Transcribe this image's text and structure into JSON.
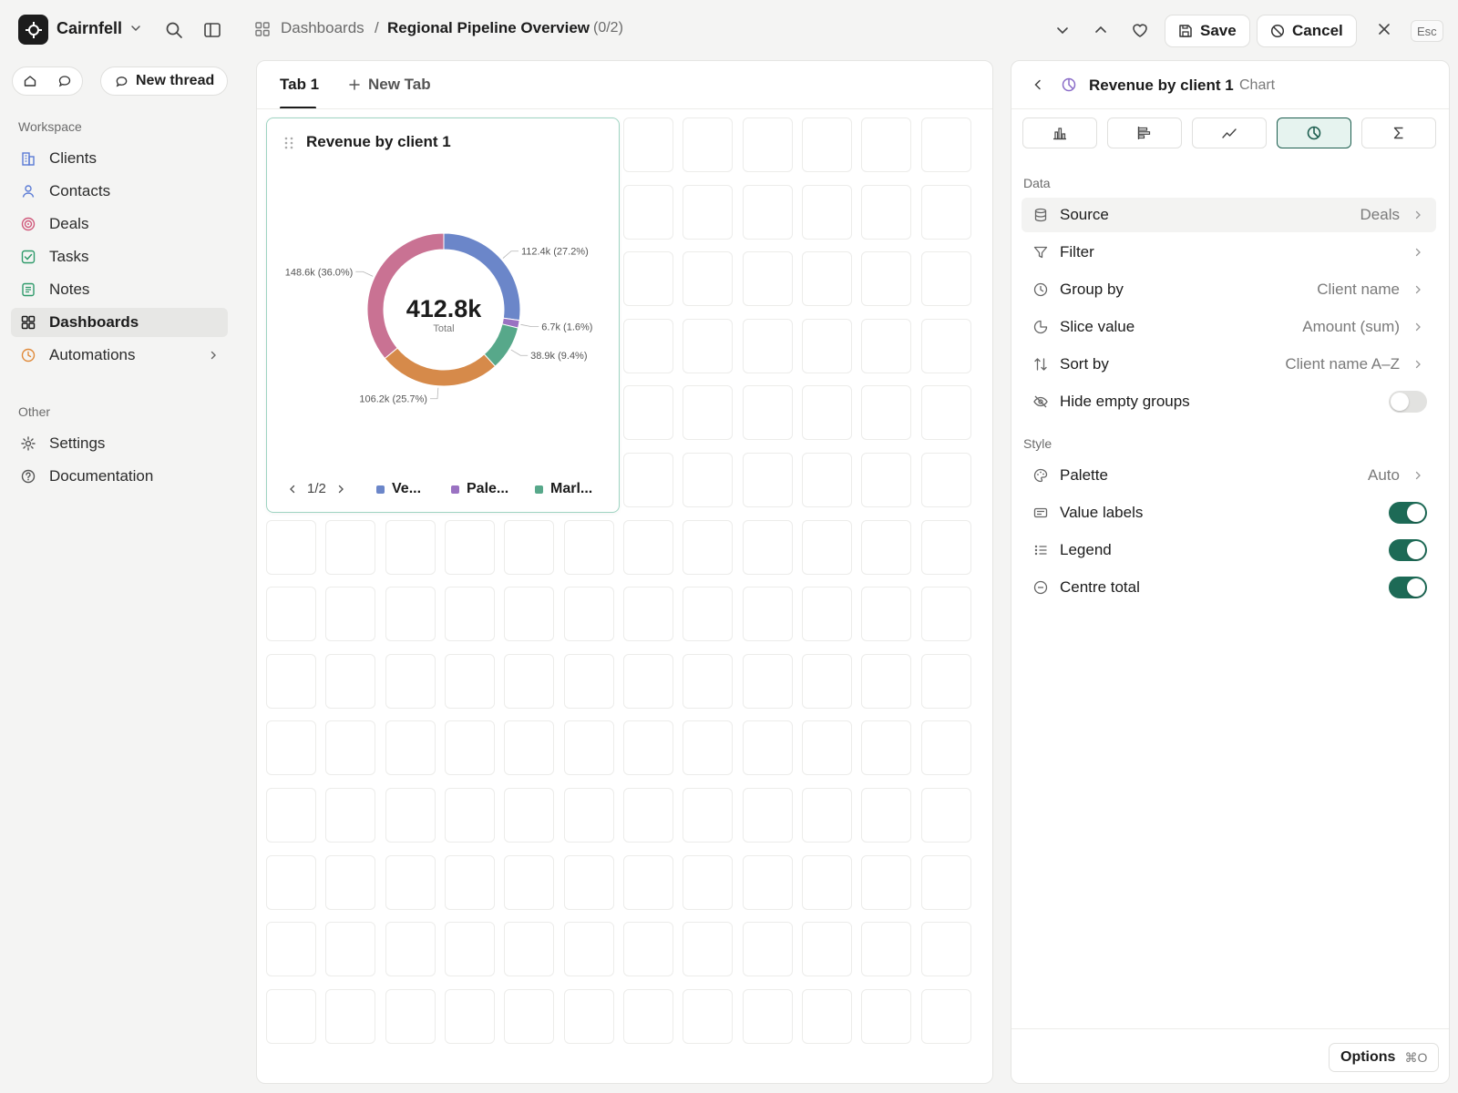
{
  "topbar": {
    "workspace_name": "Cairnfell",
    "breadcrumb_root": "Dashboards",
    "breadcrumb_sep": "/",
    "breadcrumb_current": "Regional Pipeline Overview",
    "breadcrumb_count": "(0/2)",
    "save_label": "Save",
    "cancel_label": "Cancel",
    "esc_label": "Esc"
  },
  "sidebar": {
    "new_thread_label": "New thread",
    "workspace_section": "Workspace",
    "workspace_items": [
      {
        "label": "Clients",
        "icon": "building-icon",
        "color": "#5b7bd5"
      },
      {
        "label": "Contacts",
        "icon": "person-icon",
        "color": "#5b7bd5"
      },
      {
        "label": "Deals",
        "icon": "target-icon",
        "color": "#d05a7c"
      },
      {
        "label": "Tasks",
        "icon": "checkbox-icon",
        "color": "#2e9a6a"
      },
      {
        "label": "Notes",
        "icon": "note-icon",
        "color": "#2e9a6a"
      },
      {
        "label": "Dashboards",
        "icon": "grid-icon",
        "color": "#1c1c1c",
        "active": true
      },
      {
        "label": "Automations",
        "icon": "clock-icon",
        "color": "#e08a3a"
      }
    ],
    "other_section": "Other",
    "other_items": [
      {
        "label": "Settings",
        "icon": "gear-icon"
      },
      {
        "label": "Documentation",
        "icon": "help-icon"
      }
    ]
  },
  "main": {
    "tabs": [
      {
        "label": "Tab 1"
      }
    ],
    "new_tab_label": "New Tab",
    "widget": {
      "title": "Revenue by client 1",
      "center_value": "412.8k",
      "center_label": "Total",
      "pager": "1/2",
      "legend": [
        {
          "label": "Ve...",
          "color": "#6b86c9"
        },
        {
          "label": "Pale...",
          "color": "#9a72c2"
        },
        {
          "label": "Marl...",
          "color": "#57a88a"
        }
      ]
    }
  },
  "chart_data": {
    "type": "pie",
    "title": "Revenue by client 1",
    "total": 412.8,
    "slices": [
      {
        "value": 112.4,
        "percent": 27.2,
        "label": "112.4k (27.2%)",
        "color": "#6b86c9"
      },
      {
        "value": 6.7,
        "percent": 1.6,
        "label": "6.7k (1.6%)",
        "color": "#9a72c2"
      },
      {
        "value": 38.9,
        "percent": 9.4,
        "label": "38.9k (9.4%)",
        "color": "#57a88a"
      },
      {
        "value": 106.2,
        "percent": 25.7,
        "label": "106.2k (25.7%)",
        "color": "#d68a4a"
      },
      {
        "value": 148.6,
        "percent": 36.0,
        "label": "148.6k (36.0%)",
        "color": "#c97293"
      }
    ]
  },
  "panel": {
    "title": "Revenue by client 1",
    "subtitle": "Chart",
    "chart_types": [
      "bar-chart-icon",
      "horizontal-bar-icon",
      "line-chart-icon",
      "pie-chart-icon",
      "sum-icon"
    ],
    "selected_chart_type": 3,
    "data_section": "Data",
    "data_rows": [
      {
        "label": "Source",
        "value": "Deals",
        "icon": "database-icon"
      },
      {
        "label": "Filter",
        "value": "",
        "icon": "filter-icon"
      },
      {
        "label": "Group by",
        "value": "Client name",
        "icon": "group-icon"
      },
      {
        "label": "Slice value",
        "value": "Amount (sum)",
        "icon": "slice-icon"
      },
      {
        "label": "Sort by",
        "value": "Client name A–Z",
        "icon": "sort-icon"
      },
      {
        "label": "Hide empty groups",
        "icon": "eye-off-icon",
        "toggle": false
      }
    ],
    "style_section": "Style",
    "style_rows": [
      {
        "label": "Palette",
        "value": "Auto",
        "icon": "palette-icon"
      },
      {
        "label": "Value labels",
        "icon": "label-icon",
        "toggle": true
      },
      {
        "label": "Legend",
        "icon": "list-icon",
        "toggle": true
      },
      {
        "label": "Centre total",
        "icon": "minus-circle-icon",
        "toggle": true
      }
    ],
    "options_label": "Options",
    "options_shortcut": "⌘O"
  },
  "colors": {
    "accent": "#1d6a56",
    "selection_border": "#9fd4c2"
  }
}
